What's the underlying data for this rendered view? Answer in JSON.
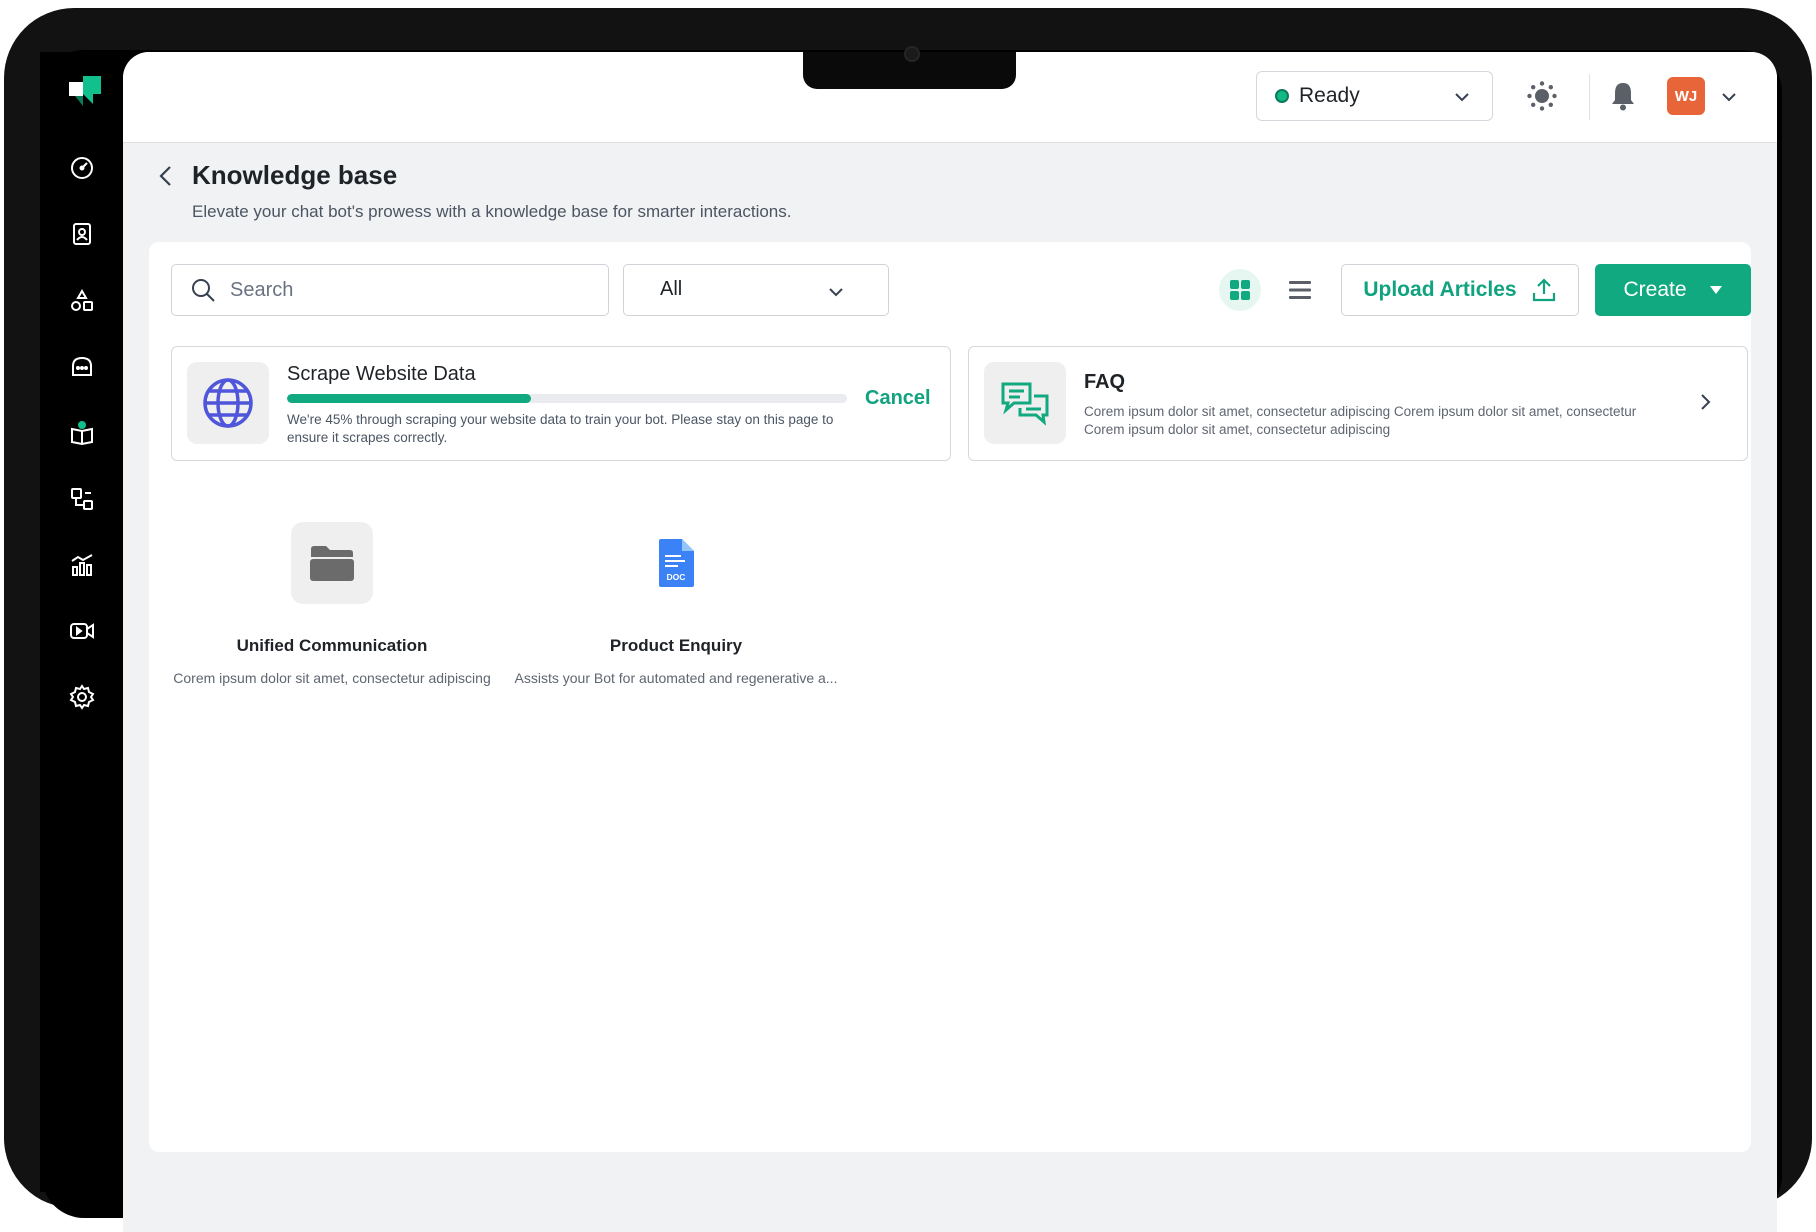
{
  "topbar": {
    "status": "Ready",
    "avatar_initials": "WJ"
  },
  "page": {
    "title": "Knowledge base",
    "subtitle": "Elevate your chat bot's prowess with a knowledge base for smarter interactions."
  },
  "toolbar": {
    "search_placeholder": "Search",
    "filter_value": "All",
    "upload_label": "Upload Articles",
    "create_label": "Create"
  },
  "scrape_card": {
    "title": "Scrape Website Data",
    "progress_percent": 45,
    "description": "We're 45% through scraping your website data to train your bot. Please stay on this page to ensure it scrapes correctly.",
    "cancel_label": "Cancel"
  },
  "faq_card": {
    "title": "FAQ",
    "description": "Corem ipsum dolor sit amet, consectetur adipiscing Corem ipsum dolor sit amet, consectetur Corem ipsum dolor sit amet, consectetur adipiscing"
  },
  "items": [
    {
      "title": "Unified Communication",
      "description": "Corem ipsum dolor sit amet, consectetur adipiscing",
      "icon": "folder-icon"
    },
    {
      "title": "Product Enquiry",
      "description": "Assists your Bot for automated and regenerative a...",
      "icon": "doc-file-icon",
      "icon_label": "DOC"
    }
  ],
  "colors": {
    "accent": "#11a97f",
    "avatar": "#e8653a",
    "status_ready": "#12b886"
  }
}
